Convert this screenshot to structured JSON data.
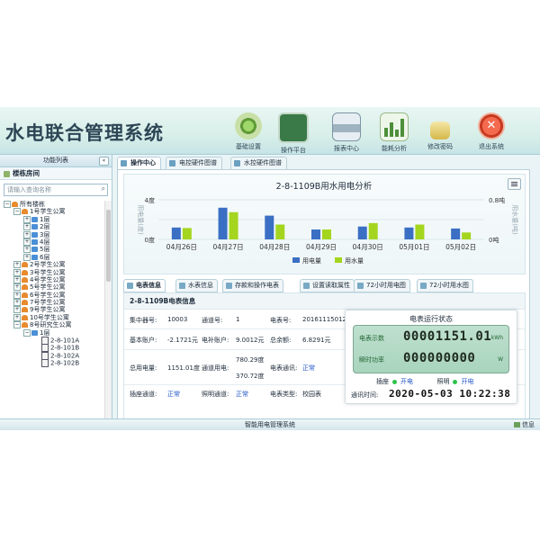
{
  "app": {
    "title": "水电联合管理系统",
    "status_center": "智能用电管理系统",
    "status_right": "信息"
  },
  "toolbar": [
    {
      "label": "基础设置",
      "icon": "gear-icon"
    },
    {
      "label": "操作平台",
      "icon": "monitor-icon"
    },
    {
      "label": "报表中心",
      "icon": "printer-icon"
    },
    {
      "label": "能耗分析",
      "icon": "bar-chart-icon"
    },
    {
      "label": "修改密码",
      "icon": "lock-icon"
    },
    {
      "label": "退出系统",
      "icon": "exit-icon"
    }
  ],
  "sidebar": {
    "title": "功能列表",
    "collapse": "«",
    "section": "楼栋房间",
    "search_placeholder": "请输入查询名称",
    "tree": [
      {
        "level": 0,
        "toggle": "⊟",
        "icon": "house",
        "label": "所有楼栋"
      },
      {
        "level": 1,
        "toggle": "⊟",
        "icon": "house",
        "label": "1号学生公寓"
      },
      {
        "level": 2,
        "toggle": "⊞",
        "icon": "floor",
        "label": "1层"
      },
      {
        "level": 2,
        "toggle": "⊞",
        "icon": "floor",
        "label": "2层"
      },
      {
        "level": 2,
        "toggle": "⊞",
        "icon": "floor",
        "label": "3层"
      },
      {
        "level": 2,
        "toggle": "⊞",
        "icon": "floor",
        "label": "4层"
      },
      {
        "level": 2,
        "toggle": "⊞",
        "icon": "floor",
        "label": "5层"
      },
      {
        "level": 2,
        "toggle": "⊞",
        "icon": "floor",
        "label": "6层"
      },
      {
        "level": 1,
        "toggle": "⊞",
        "icon": "house",
        "label": "2号学生公寓"
      },
      {
        "level": 1,
        "toggle": "⊞",
        "icon": "house",
        "label": "3号学生公寓"
      },
      {
        "level": 1,
        "toggle": "⊞",
        "icon": "house",
        "label": "4号学生公寓"
      },
      {
        "level": 1,
        "toggle": "⊞",
        "icon": "house",
        "label": "5号学生公寓"
      },
      {
        "level": 1,
        "toggle": "⊞",
        "icon": "house",
        "label": "6号学生公寓"
      },
      {
        "level": 1,
        "toggle": "⊞",
        "icon": "house",
        "label": "7号学生公寓"
      },
      {
        "level": 1,
        "toggle": "⊞",
        "icon": "house",
        "label": "9号学生公寓"
      },
      {
        "level": 1,
        "toggle": "⊞",
        "icon": "house",
        "label": "10号学生公寓"
      },
      {
        "level": 1,
        "toggle": "⊟",
        "icon": "house",
        "label": "8号研究生公寓"
      },
      {
        "level": 2,
        "toggle": "⊟",
        "icon": "floor",
        "label": "1层"
      },
      {
        "level": 3,
        "toggle": "",
        "icon": "room",
        "label": "2-8-101A"
      },
      {
        "level": 3,
        "toggle": "",
        "icon": "room",
        "label": "2-8-101B"
      },
      {
        "level": 3,
        "toggle": "",
        "icon": "room",
        "label": "2-8-102A"
      },
      {
        "level": 3,
        "toggle": "",
        "icon": "room",
        "label": "2-8-102B"
      }
    ]
  },
  "tabs": [
    {
      "label": "操作中心",
      "active": true
    },
    {
      "label": "电控硬件图谱",
      "active": false
    },
    {
      "label": "水控硬件图谱",
      "active": false
    }
  ],
  "chart_data": {
    "type": "bar",
    "title": "2-8-1109B用水用电分析",
    "categories": [
      "04月26日",
      "04月27日",
      "04月28日",
      "04月29日",
      "04月30日",
      "05月01日",
      "05月02日"
    ],
    "ylabel_left": "用电量(度)",
    "ylabel_right": "用水量(吨)",
    "left_ticks": [
      "0度",
      "2度",
      "4度"
    ],
    "right_ticks": [
      "0吨",
      "0.8吨"
    ],
    "ylim_left": [
      0,
      4
    ],
    "ylim_right": [
      0,
      0.8
    ],
    "grid": true,
    "legend_position": "bottom",
    "series": [
      {
        "name": "用电量",
        "axis": "left",
        "color": "#3a6fc4",
        "values": [
          1.2,
          3.2,
          2.4,
          1.0,
          1.3,
          1.2,
          1.1
        ]
      },
      {
        "name": "用水量",
        "axis": "right",
        "color": "#a4d61f",
        "values": [
          0.23,
          0.55,
          0.3,
          0.2,
          0.33,
          0.3,
          0.14
        ]
      }
    ]
  },
  "subtabs": [
    {
      "label": "电表信息",
      "active": true
    },
    {
      "label": "水表信息",
      "active": false
    },
    {
      "label": "存款和操作电表",
      "active": false
    },
    {
      "label": "设置读取属性",
      "active": false
    },
    {
      "label": "72小时用电图",
      "active": false
    },
    {
      "label": "72小时用水图",
      "active": false
    }
  ],
  "meter": {
    "title": "2-8-1109B电表信息",
    "concentrator_label": "集中器号:",
    "concentrator": "10003",
    "channel_label": "通道号:",
    "channel": "1",
    "meter_no_label": "电表号:",
    "meter_no": "201611150127",
    "basic_account_label": "基本账户:",
    "basic_account": "-2.1721元",
    "subsidy_account_label": "电补账户:",
    "subsidy_account": "9.0012元",
    "total_balance_label": "总余额:",
    "total_balance": "6.8291元",
    "total_usage_label": "总用电量:",
    "total_usage": "1151.01度",
    "channel_usage_label": "通道用电:",
    "channel_usage_a": "780.29度",
    "channel_usage_b": "370.72度",
    "meter_comm_label": "电表通讯:",
    "meter_comm": "正常",
    "socket_channel_label": "插座通道:",
    "socket_channel": "正常",
    "light_channel_label": "照明通道:",
    "light_channel": "正常",
    "meter_type_label": "电表类型:",
    "meter_type": "校园表"
  },
  "device": {
    "title": "电表运行状态",
    "reading_label": "电表示数",
    "reading": "00001151.01",
    "reading_unit": "kWh",
    "power_label": "瞬时功率",
    "power": "000000000",
    "power_unit": "W",
    "socket_label": "插座",
    "socket_state": "开电",
    "light_label": "照明",
    "light_state": "开电",
    "comm_time_label": "通讯时间:",
    "comm_time": "2020-05-03 10:22:38"
  }
}
